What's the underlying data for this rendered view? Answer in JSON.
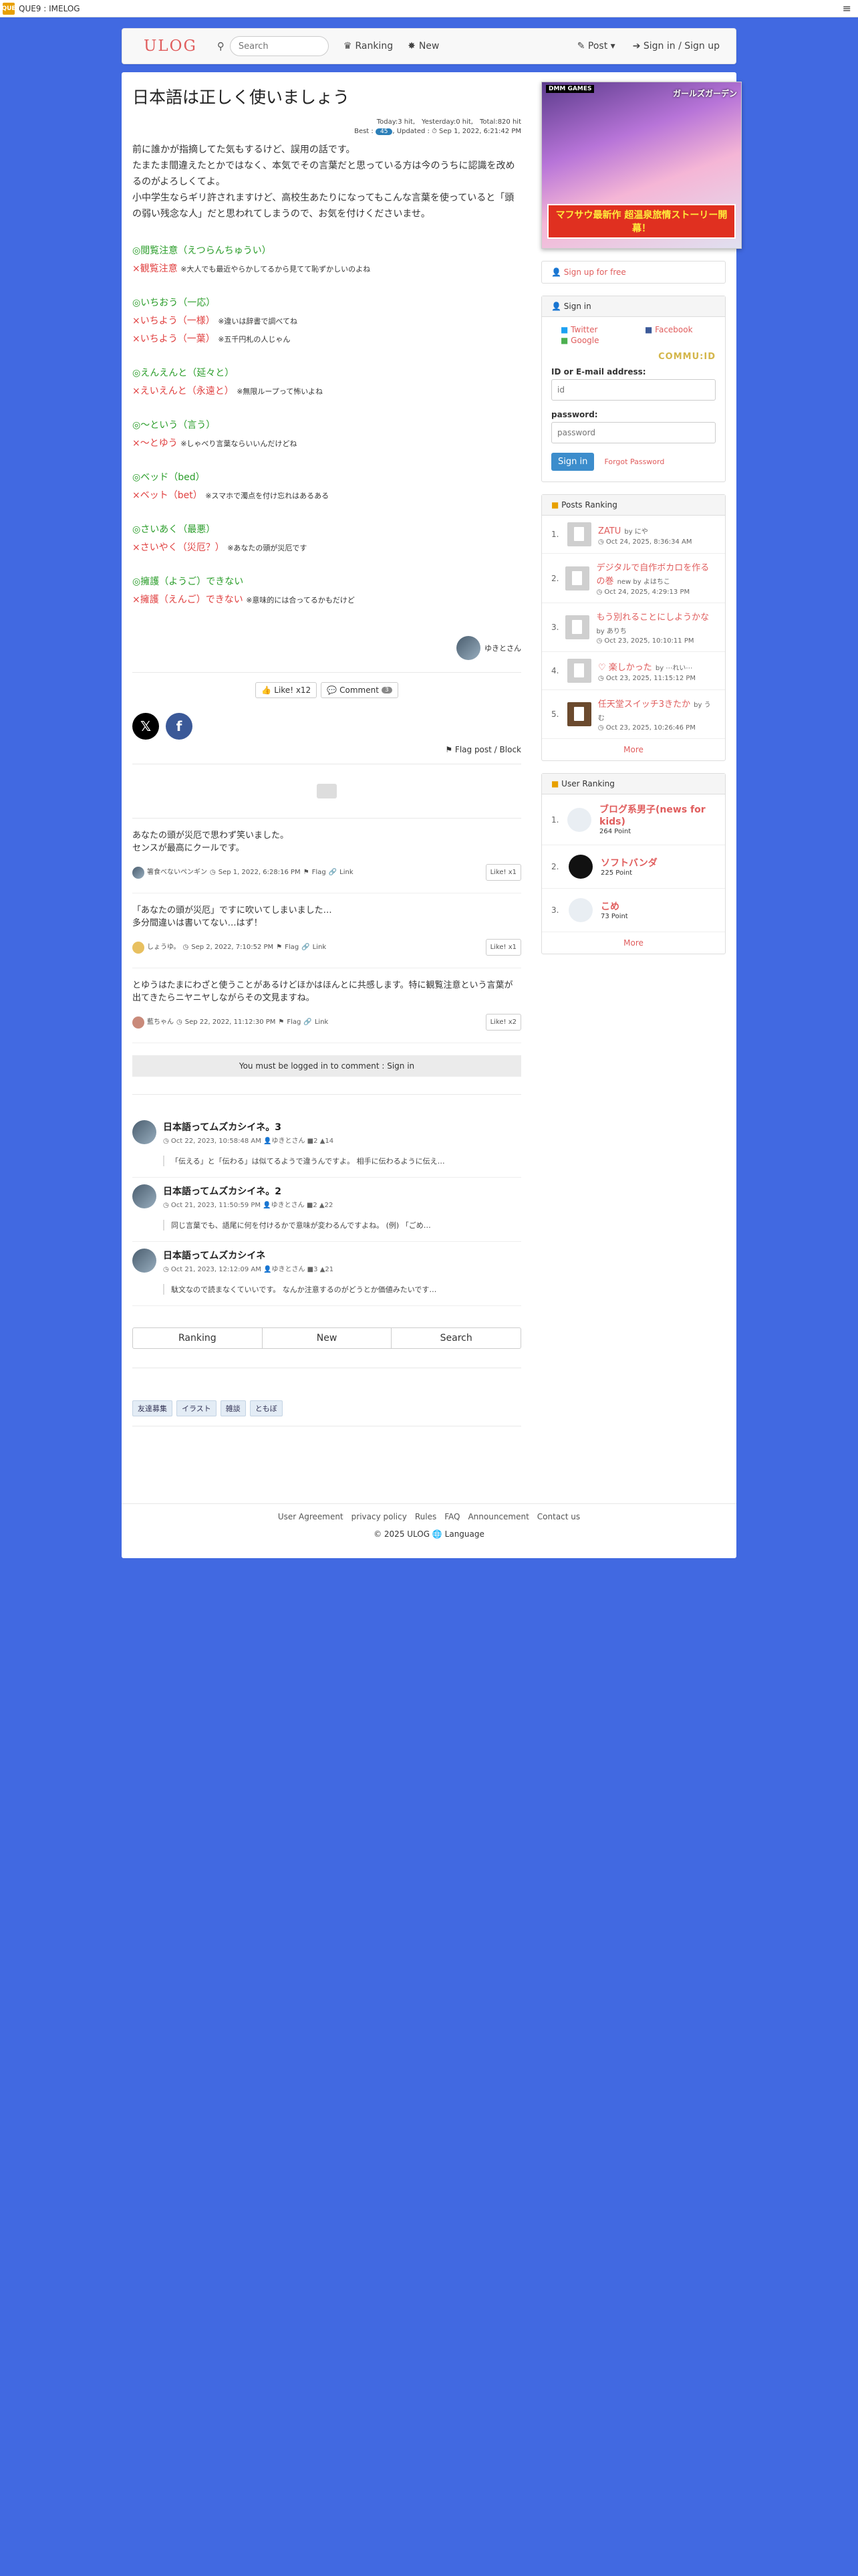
{
  "topbar": {
    "favicon": "QUE",
    "title": "QUE9 : IMELOG",
    "menu_icon": "≡"
  },
  "nav": {
    "brand": "ULOG",
    "search_placeholder": "Search",
    "ranking": "Ranking",
    "new": "New",
    "post": "Post",
    "signin": "Sign in / Sign up"
  },
  "article": {
    "title": "日本語は正しく使いましょう",
    "meta_line1": "Today:3 hit,　Yesterday:0 hit,　Total:820 hit",
    "meta_best": "Best :",
    "meta_badge": "45",
    "meta_updated": ", Updated : ⏱ Sep 1, 2022, 6:21:42 PM",
    "intro": [
      "前に誰かが指摘してた気もするけど、誤用の話です。",
      "たまたま間違えたとかではなく、本気でその言葉だと思っている方は今のうちに認識を改めるのがよろしくてよ。",
      "小中学生ならギリ許されますけど、高校生あたりになってもこんな言葉を使っていると「頭の弱い残念な人」だと思われてしまうので、お気を付けくださいませ。"
    ],
    "entries": [
      {
        "ok": "◎閲覧注意（えつらんちゅうい）",
        "ng": "×観覧注意",
        "note": "※大人でも最近やらかしてるから見てて恥ずかしいのよね"
      },
      {
        "ok": "◎いちおう（一応）",
        "ng": "×いちよう（一様）",
        "note": "※違いは辞書で調べてね",
        "ng2": "×いちよう（一葉）",
        "note2": "※五千円札の人じゃん"
      },
      {
        "ok": "◎えんえんと（延々と）",
        "ng": "×えいえんと（永遠と）",
        "note": "※無限ループって怖いよね"
      },
      {
        "ok": "◎〜という（言う）",
        "ng": "×〜とゆう",
        "note": "※しゃべり言葉ならいいんだけどね"
      },
      {
        "ok": "◎ベッド（bed）",
        "ng": "×ベット（bet）",
        "note": "※スマホで濁点を付け忘れはあるある"
      },
      {
        "ok": "◎さいあく（最悪）",
        "ng": "×さいやく（災厄？）",
        "note": "※あなたの頭が災厄です"
      },
      {
        "ok": "◎擁護（ようご）できない",
        "ng": "×擁護（えんご）できない",
        "note": "※意味的には合ってるかもだけど"
      }
    ],
    "author": "ゆきとさん",
    "like_label": "Like! x12",
    "comment_label": "Comment",
    "comment_count": "3",
    "share_x": "𝕏",
    "share_fb": "f",
    "flag_label": "Flag post / Block"
  },
  "comments": [
    {
      "text1": "あなたの頭が災厄で思わず笑いました。",
      "text2": "センスが最高にクールです。",
      "user": "箸食べないペンギン",
      "date": "Sep 1, 2022, 6:28:16 PM",
      "flag": "Flag",
      "link": "Link",
      "like": "Like! x1"
    },
    {
      "text1": "「あなたの頭が災厄」ですに吹いてしまいました…",
      "text2": "多分間違いは書いてない…はず！",
      "user": "しょうゆ。",
      "date": "Sep 2, 2022, 7:10:52 PM",
      "flag": "Flag",
      "link": "Link",
      "like": "Like! x1"
    },
    {
      "text1": "とゆうはたまにわざと使うことがあるけどほかはほんとに共感します。特に観覧注意という言葉が出てきたらニヤニヤしながらその文見ますね。",
      "text2": "",
      "user": "藍ちゃん",
      "date": "Sep 22, 2022, 11:12:30 PM",
      "flag": "Flag",
      "link": "Link",
      "like": "Like! x2"
    }
  ],
  "login_notice": "You must be logged in to comment : Sign in",
  "related": [
    {
      "title": "日本語ってムズカシイネ。3",
      "date": "Oct 22, 2023, 10:58:48 AM",
      "user": "ゆきとさん",
      "c": "2",
      "h": "14",
      "excerpt": "「伝える」と「伝わる」は似てるようで違うんですよ。 相手に伝わるように伝え…"
    },
    {
      "title": "日本語ってムズカシイネ。2",
      "date": "Oct 21, 2023, 11:50:59 PM",
      "user": "ゆきとさん",
      "c": "2",
      "h": "22",
      "excerpt": "同じ言葉でも、語尾に何を付けるかで意味が変わるんですよね。 (例) 「ごめ…"
    },
    {
      "title": "日本語ってムズカシイネ",
      "date": "Oct 21, 2023, 12:12:09 AM",
      "user": "ゆきとさん",
      "c": "3",
      "h": "21",
      "excerpt": "駄文なので読まなくていいです。 なんか注意するのがどうとか価値みたいです…"
    }
  ],
  "tabs": [
    "Ranking",
    "New",
    "Search"
  ],
  "tags": [
    "友達募集",
    "イラスト",
    "雑談",
    "ともぼ"
  ],
  "footer": {
    "links": [
      "User Agreement",
      "privacy policy",
      "Rules",
      "FAQ",
      "Announcement",
      "Contact us"
    ],
    "copy": "© 2025  ULOG",
    "lang": "Language"
  },
  "sidebar": {
    "ad_brand": "DMM GAMES",
    "ad_title": "ガールズガーデン",
    "ad_banner": "マフサウ最新作 超温泉旅情ストーリー開幕！",
    "signup": "Sign up for free",
    "signin_header": "Sign in",
    "social": [
      "Twitter",
      "Facebook",
      "Google"
    ],
    "commu": "COMMU:ID",
    "id_label": "ID or E-mail address:",
    "id_placeholder": "id",
    "pw_label": "password:",
    "pw_placeholder": "password",
    "signin_btn": "Sign in",
    "forgot": "Forgot Password",
    "posts_header": "Posts Ranking",
    "posts": [
      {
        "title": "ZATU",
        "by": "by にや",
        "date": "Oct 24, 2025, 8:36:34 AM"
      },
      {
        "title": "デジタルで自作ボカロを作るの巻",
        "by": "new by よはちこ",
        "date": "Oct 24, 2025, 4:29:13 PM"
      },
      {
        "title": "もう別れることにしようかな",
        "by": "by ありち",
        "date": "Oct 23, 2025, 10:10:11 PM"
      },
      {
        "title": "♡ 楽しかった",
        "by": "by ⋯れい⋯",
        "date": "Oct 23, 2025, 11:15:12 PM"
      },
      {
        "title": "任天堂スイッチ3きたか",
        "by": "by うむ",
        "date": "Oct 23, 2025, 10:26:46 PM"
      }
    ],
    "more": "More",
    "users_header": "User Ranking",
    "users": [
      {
        "name": "ブログ系男子(news for kids)",
        "pts": "264 Point"
      },
      {
        "name": "ソフトバンダ",
        "pts": "225 Point"
      },
      {
        "name": "こめ",
        "pts": "73 Point"
      }
    ]
  },
  "colors": {
    "background": "#4169e1",
    "accent": "#e05d5d",
    "ok": "#2a9d2a",
    "ng": "#e04040"
  }
}
